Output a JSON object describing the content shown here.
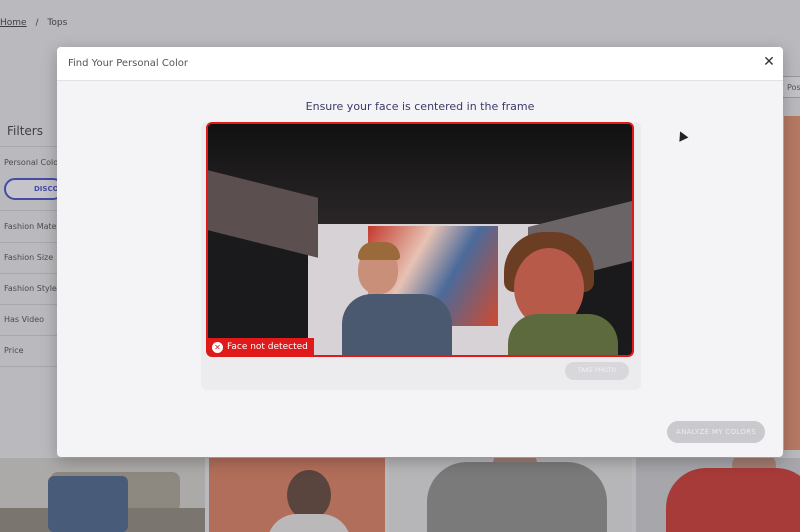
{
  "breadcrumb": {
    "home": "Home",
    "separator": "/",
    "current": "Tops"
  },
  "filters": {
    "title": "Filters",
    "items": [
      "Personal Colors",
      "Fashion Material",
      "Fashion Size",
      "Fashion Style",
      "Has Video",
      "Price"
    ],
    "disco_button": "DISCO"
  },
  "right_pill": "Pos",
  "modal": {
    "title": "Find Your Personal Color",
    "close_icon": "close-icon",
    "instruction": "Ensure your face is centered in the frame",
    "face_status": "Face not detected",
    "capture_button": "TAKE PHOTO",
    "analyze_button": "ANALYZE MY COLORS"
  },
  "colors": {
    "frame_border": "#e01a1a",
    "status_badge": "#e01a1a",
    "accent": "#3a45c8",
    "disabled_button": "#c9c9ce"
  }
}
